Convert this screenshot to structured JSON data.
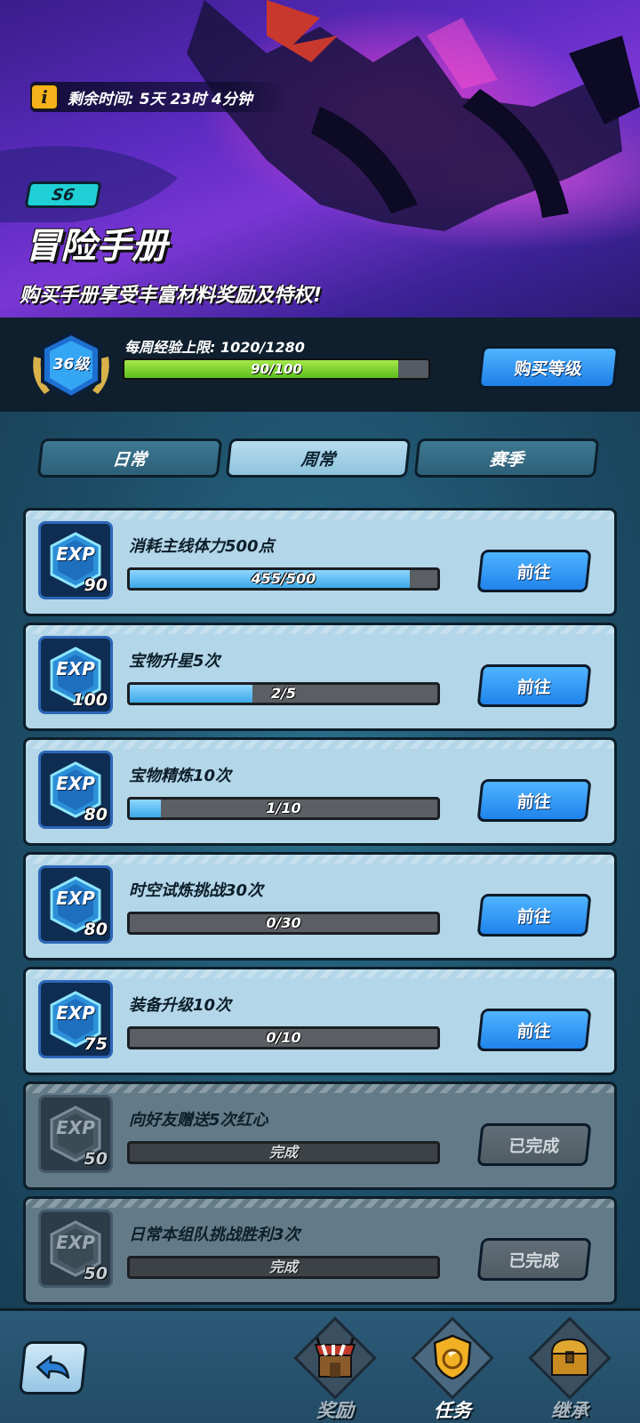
{
  "banner": {
    "timer_text": "剩余时间: 5天 23时 4分钟",
    "info_icon_letter": "i",
    "season": "S6",
    "title": "冒险手册",
    "subtitle": "购买手册享受丰富材料奖励及特权!"
  },
  "level": {
    "badge_text": "36级",
    "weekly_label": "每周经验上限: 1020/1280",
    "progress_text": "90/100",
    "progress_fraction": 0.9,
    "buy_button": "购买等级"
  },
  "tabs": [
    {
      "label": "日常",
      "active": false
    },
    {
      "label": "周常",
      "active": true
    },
    {
      "label": "赛季",
      "active": false
    }
  ],
  "tasks": [
    {
      "exp_label": "EXP",
      "exp": "90",
      "title": "消耗主线体力500点",
      "progress_text": "455/500",
      "fraction": 0.91,
      "button": "前往",
      "done": false
    },
    {
      "exp_label": "EXP",
      "exp": "100",
      "title": "宝物升星5次",
      "progress_text": "2/5",
      "fraction": 0.4,
      "button": "前往",
      "done": false
    },
    {
      "exp_label": "EXP",
      "exp": "80",
      "title": "宝物精炼10次",
      "progress_text": "1/10",
      "fraction": 0.1,
      "button": "前往",
      "done": false
    },
    {
      "exp_label": "EXP",
      "exp": "80",
      "title": "时空试炼挑战30次",
      "progress_text": "0/30",
      "fraction": 0,
      "button": "前往",
      "done": false
    },
    {
      "exp_label": "EXP",
      "exp": "75",
      "title": "装备升级10次",
      "progress_text": "0/10",
      "fraction": 0,
      "button": "前往",
      "done": false
    },
    {
      "exp_label": "EXP",
      "exp": "50",
      "title": "向好友赠送5次红心",
      "progress_text": "完成",
      "fraction": 0,
      "button": "已完成",
      "done": true
    },
    {
      "exp_label": "EXP",
      "exp": "50",
      "title": "日常本组队挑战胜利3次",
      "progress_text": "完成",
      "fraction": 0,
      "button": "已完成",
      "done": true
    }
  ],
  "nav": {
    "rewards": "奖励",
    "tasks": "任务",
    "inherit": "继承"
  },
  "colors": {
    "accent_blue": "#2b8ef0",
    "progress_green": "#7ed63a",
    "progress_blue": "#4db6ef",
    "season_cyan": "#1fd1d6"
  }
}
